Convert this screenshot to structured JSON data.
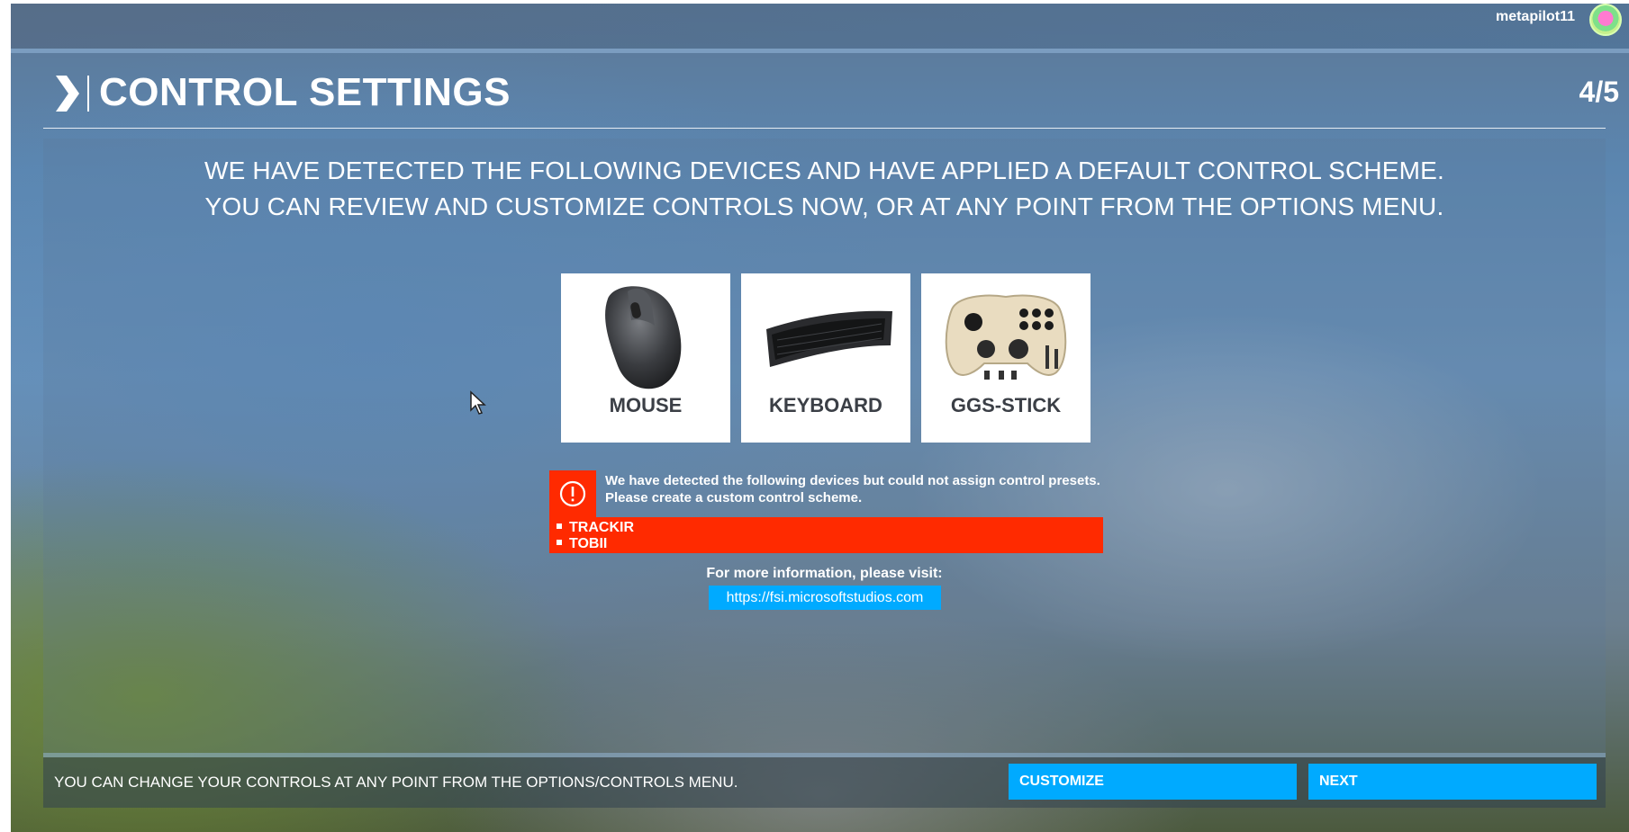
{
  "user": {
    "name": "metapilot11"
  },
  "header": {
    "title": "CONTROL SETTINGS",
    "step": "4/5"
  },
  "intro": {
    "line1": "WE HAVE DETECTED THE FOLLOWING DEVICES AND HAVE APPLIED A DEFAULT CONTROL SCHEME.",
    "line2": "YOU CAN REVIEW AND CUSTOMIZE CONTROLS NOW, OR AT ANY POINT FROM THE OPTIONS MENU."
  },
  "devices": [
    {
      "label": "MOUSE",
      "icon": "mouse-icon"
    },
    {
      "label": "KEYBOARD",
      "icon": "keyboard-icon"
    },
    {
      "label": "GGS-STICK",
      "icon": "gamepad-icon"
    }
  ],
  "alert": {
    "icon": "exclamation-circle-icon",
    "line1": "We have detected the following devices but could not assign control presets.",
    "line2": "Please create a custom control scheme.",
    "items": [
      "TRACKIR",
      "TOBII"
    ],
    "color": "#ff2a00"
  },
  "info": {
    "text": "For more information, please visit:",
    "link": "https://fsi.microsoftstudios.com"
  },
  "footer": {
    "text": "YOU CAN CHANGE YOUR CONTROLS AT ANY POINT FROM THE OPTIONS/CONTROLS MENU.",
    "customize_label": "CUSTOMIZE",
    "next_label": "NEXT"
  },
  "colors": {
    "accent": "#00aaff",
    "alert": "#ff2a00"
  }
}
